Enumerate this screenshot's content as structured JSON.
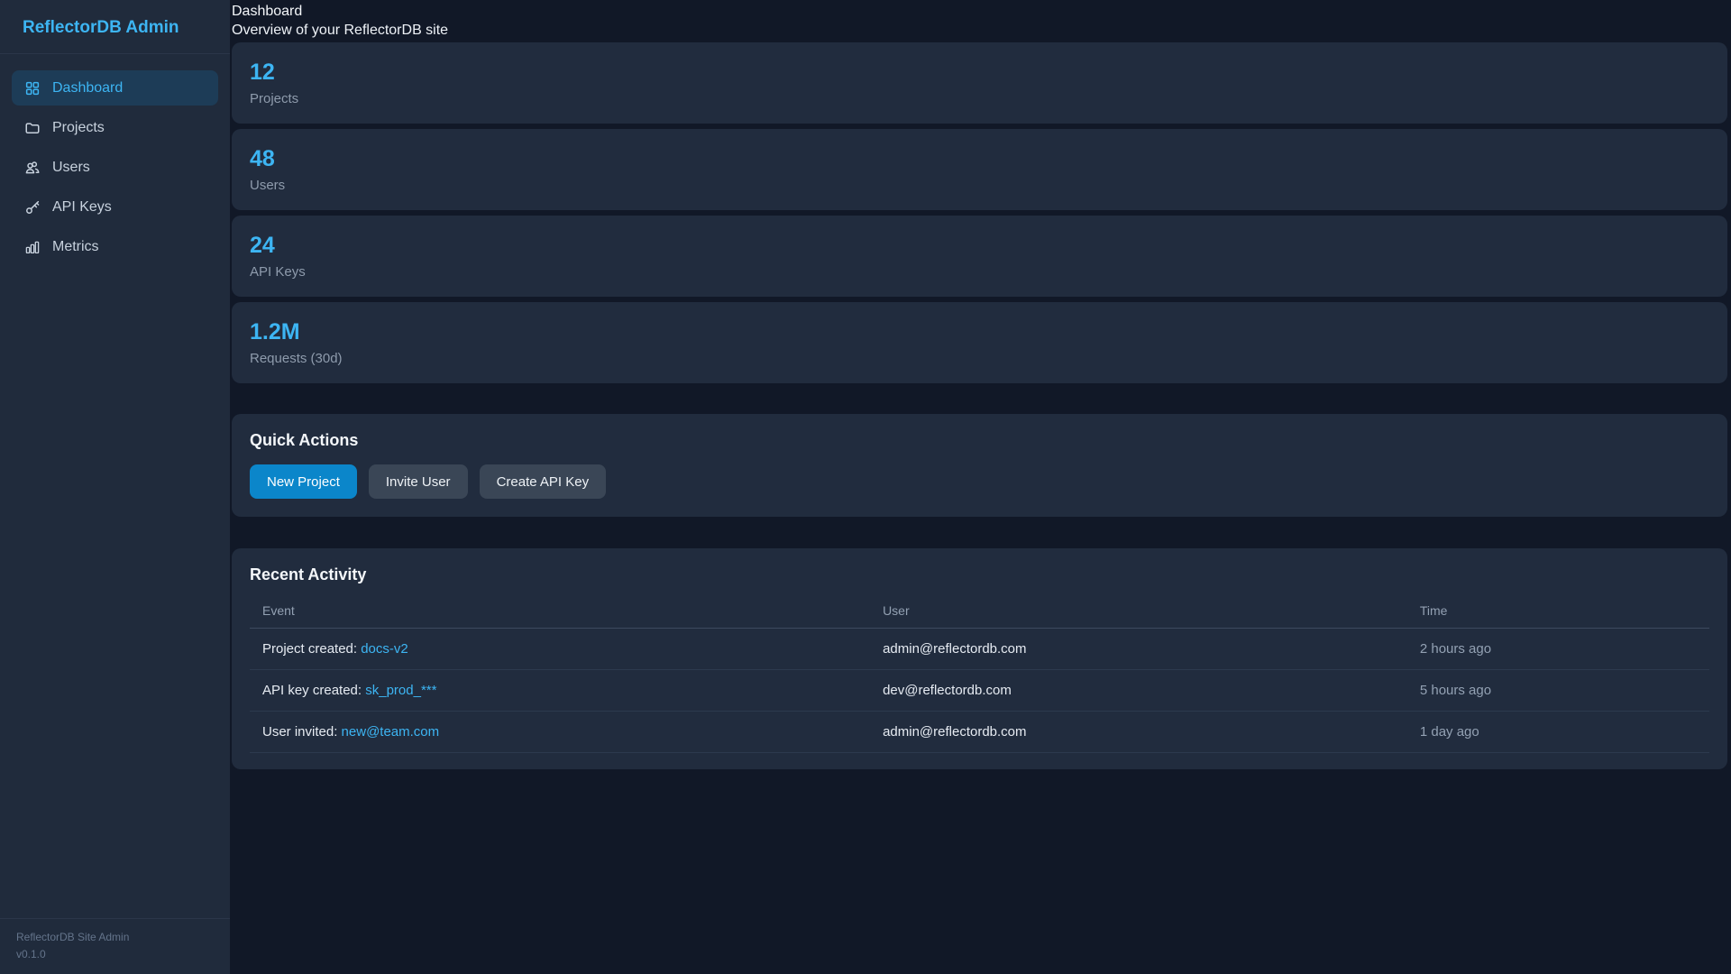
{
  "colors": {
    "accent": "#3db5f3",
    "primary_button": "#0b86ca",
    "secondary_button": "#3a4656",
    "page_bg": "#111827",
    "panel_bg": "#212c3e",
    "sidebar_bg": "#202b3c",
    "active_nav_bg": "#1d3c57",
    "muted_text": "#93a1b3"
  },
  "sidebar": {
    "title": "ReflectorDB Admin",
    "items": [
      {
        "label": "Dashboard",
        "icon": "dashboard-grid-icon",
        "active": true
      },
      {
        "label": "Projects",
        "icon": "folder-icon",
        "active": false
      },
      {
        "label": "Users",
        "icon": "users-icon",
        "active": false
      },
      {
        "label": "API Keys",
        "icon": "key-icon",
        "active": false
      },
      {
        "label": "Metrics",
        "icon": "bar-chart-icon",
        "active": false
      }
    ],
    "footer": {
      "line1": "ReflectorDB Site Admin",
      "line2": "v0.1.0"
    }
  },
  "header": {
    "title": "Dashboard",
    "subtitle": "Overview of your ReflectorDB site"
  },
  "stats": [
    {
      "value": "12",
      "label": "Projects"
    },
    {
      "value": "48",
      "label": "Users"
    },
    {
      "value": "24",
      "label": "API Keys"
    },
    {
      "value": "1.2M",
      "label": "Requests (30d)"
    }
  ],
  "quick_actions": {
    "title": "Quick Actions",
    "buttons": [
      {
        "label": "New Project",
        "variant": "primary"
      },
      {
        "label": "Invite User",
        "variant": "secondary"
      },
      {
        "label": "Create API Key",
        "variant": "secondary"
      }
    ]
  },
  "activity": {
    "title": "Recent Activity",
    "columns": [
      "Event",
      "User",
      "Time"
    ],
    "rows": [
      {
        "event_prefix": "Project created: ",
        "event_link": "docs-v2",
        "user": "admin@reflectordb.com",
        "time": "2 hours ago"
      },
      {
        "event_prefix": "API key created: ",
        "event_link": "sk_prod_***",
        "user": "dev@reflectordb.com",
        "time": "5 hours ago"
      },
      {
        "event_prefix": "User invited: ",
        "event_link": "new@team.com",
        "user": "admin@reflectordb.com",
        "time": "1 day ago"
      }
    ]
  }
}
